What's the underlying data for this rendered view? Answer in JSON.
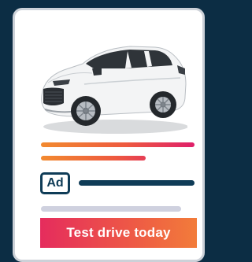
{
  "ad": {
    "badge_label": "Ad",
    "cta_label": "Test drive today",
    "image": {
      "subject": "car-image",
      "car_color": "#f4f5f6"
    }
  },
  "colors": {
    "background": "#0c2d44",
    "card": "#ffffff",
    "card_border": "#ccd1d8",
    "accent_orange": "#f28a2f",
    "accent_pink": "#df1f6a",
    "navy": "#0f3c57",
    "placeholder_gray": "#cfd1df"
  }
}
